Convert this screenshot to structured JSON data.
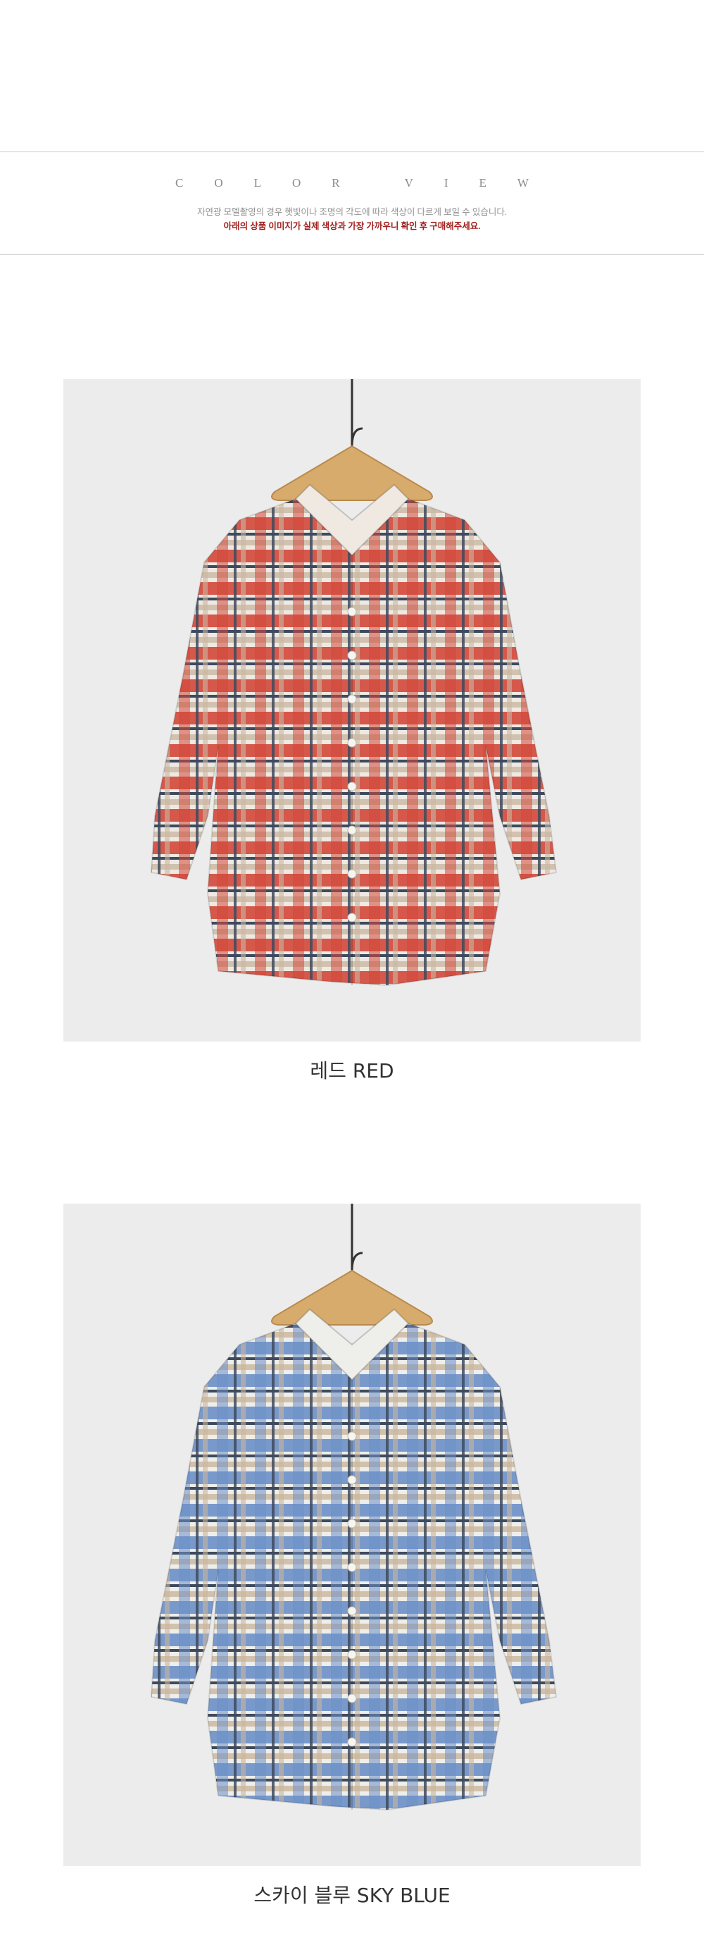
{
  "header": {
    "title": "COLOR VIEW",
    "note": "자연광 모델촬영의 경우 햇빛이나 조명의 각도에 따라 색상이 다르게 보일 수 있습니다.",
    "warning": "아래의 상품 이미지가 실제 색상과 가장 가까우니 확인 후 구매해주세요."
  },
  "products": [
    {
      "caption": "레드 RED",
      "image": "red-plaid-shirt-on-hanger",
      "colors": {
        "base": "#d2483b",
        "accent": "#3e4a5e",
        "light": "#efe9e2",
        "tan": "#c9b7a2"
      }
    },
    {
      "caption": "스카이 블루 SKY BLUE",
      "image": "sky-blue-plaid-shirt-on-hanger",
      "colors": {
        "base": "#6c8fc8",
        "accent": "#3e4a5e",
        "light": "#eeeeea",
        "tan": "#c9b59c"
      }
    }
  ]
}
